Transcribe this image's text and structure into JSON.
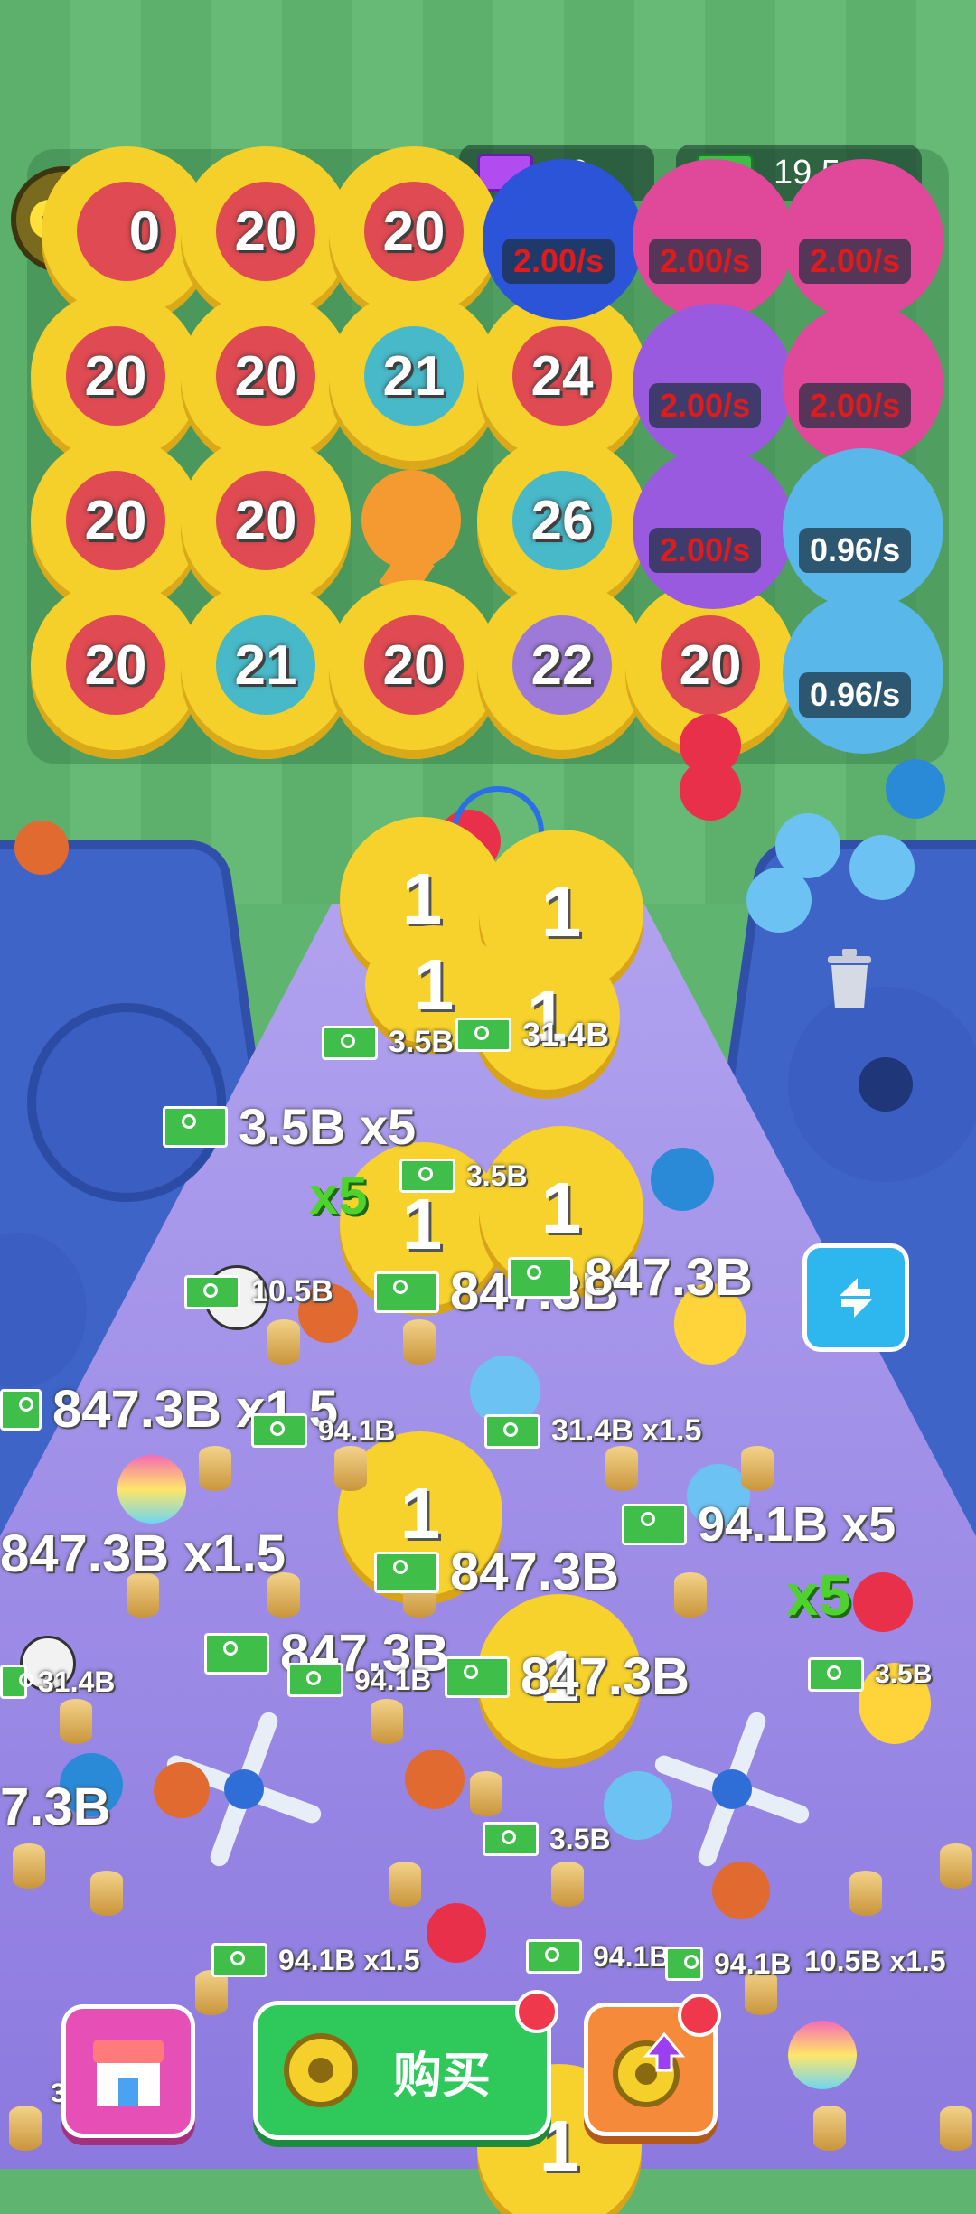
{
  "hud": {
    "tickets": "0",
    "cash": "19.5aa"
  },
  "grid_gears": [
    {
      "label": "20"
    },
    {
      "label": "20"
    },
    {
      "label": "20"
    },
    {
      "label": "20"
    },
    {
      "label": "20"
    },
    {
      "label": "21"
    },
    {
      "label": "24"
    },
    {
      "label": "20"
    },
    {
      "label": "20"
    },
    {
      "label": "26"
    },
    {
      "label": "20"
    },
    {
      "label": "21"
    },
    {
      "label": "20"
    },
    {
      "label": "22"
    },
    {
      "label": "20"
    }
  ],
  "gear_first_partial": "0",
  "rates": [
    {
      "label": "2.00/s",
      "color": "#e01b1b"
    },
    {
      "label": "2.00/s",
      "color": "#e01b1b"
    },
    {
      "label": "2.00/s",
      "color": "#e01b1b"
    },
    {
      "label": "2.00/s",
      "color": "#e01b1b"
    },
    {
      "label": "2.00/s",
      "color": "#e01b1b"
    },
    {
      "label": "2.00/s",
      "color": "#e01b1b"
    },
    {
      "label": "0.96/s",
      "color": "#ffffff"
    },
    {
      "label": "0.96/s",
      "color": "#ffffff"
    }
  ],
  "lane_gears": [
    "1",
    "1",
    "1",
    "1",
    "1",
    "1",
    "1",
    "1",
    "1"
  ],
  "money_popups": [
    "3.5B",
    "31.4B",
    "3.5B x5",
    "3.5B",
    "10.5B",
    "847.3B",
    "847.3B",
    "847.3B x1.5",
    "94.1B",
    "31.4B x1.5",
    "847.3B x1.5",
    "94.1B x5",
    "847.3B",
    "3.5B",
    "847.3B",
    "847.3B",
    "94.1B",
    "31.4B",
    "3.5B",
    "7.3B",
    "3.5B",
    "94.1B x1.5",
    "94.1B",
    "94.1B",
    "10.5B x1.5"
  ],
  "multipliers": [
    "x5",
    "x5"
  ],
  "buttons": {
    "buy_label": "购买"
  },
  "colors": {
    "gear_yellow": "#f5cf2a",
    "lane_purple": "#9c8be6",
    "panel_blue": "#3f64c8",
    "buy_green": "#2fc85a"
  }
}
